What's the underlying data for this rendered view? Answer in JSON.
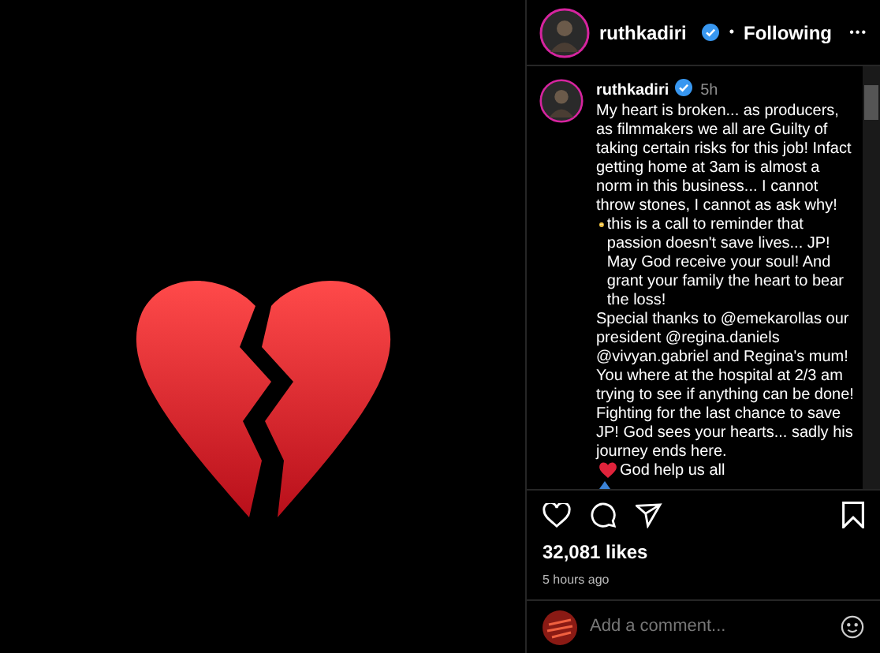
{
  "post": {
    "author": "ruthkadiri",
    "verified": true,
    "follow_separator": "•",
    "follow_status": "Following",
    "more": "•••"
  },
  "caption": {
    "author": "ruthkadiri",
    "verified": true,
    "time": "5h",
    "parts": [
      "My heart is broken... as producers, as filmmakers we all are Guilty of taking certain risks for this job! Infact getting home at 3am is almost a norm in this business... I cannot throw stones, I cannot as ask why!",
      "this is a call to reminder that passion doesn't save lives... JP! May God receive your soul! And grant your family the heart to bear the loss!",
      "Special thanks to @emekarollas our president @regina.daniels @vivyan.gabriel and Regina's mum! You where at the hospital at 2/3 am trying to see if anything can be done! Fighting for the last chance to save JP! God sees your hearts... sadly his journey ends here.",
      "God help us all"
    ]
  },
  "likes": "32,081 likes",
  "posted": "5 hours ago",
  "comment": {
    "placeholder": "Add a comment..."
  }
}
